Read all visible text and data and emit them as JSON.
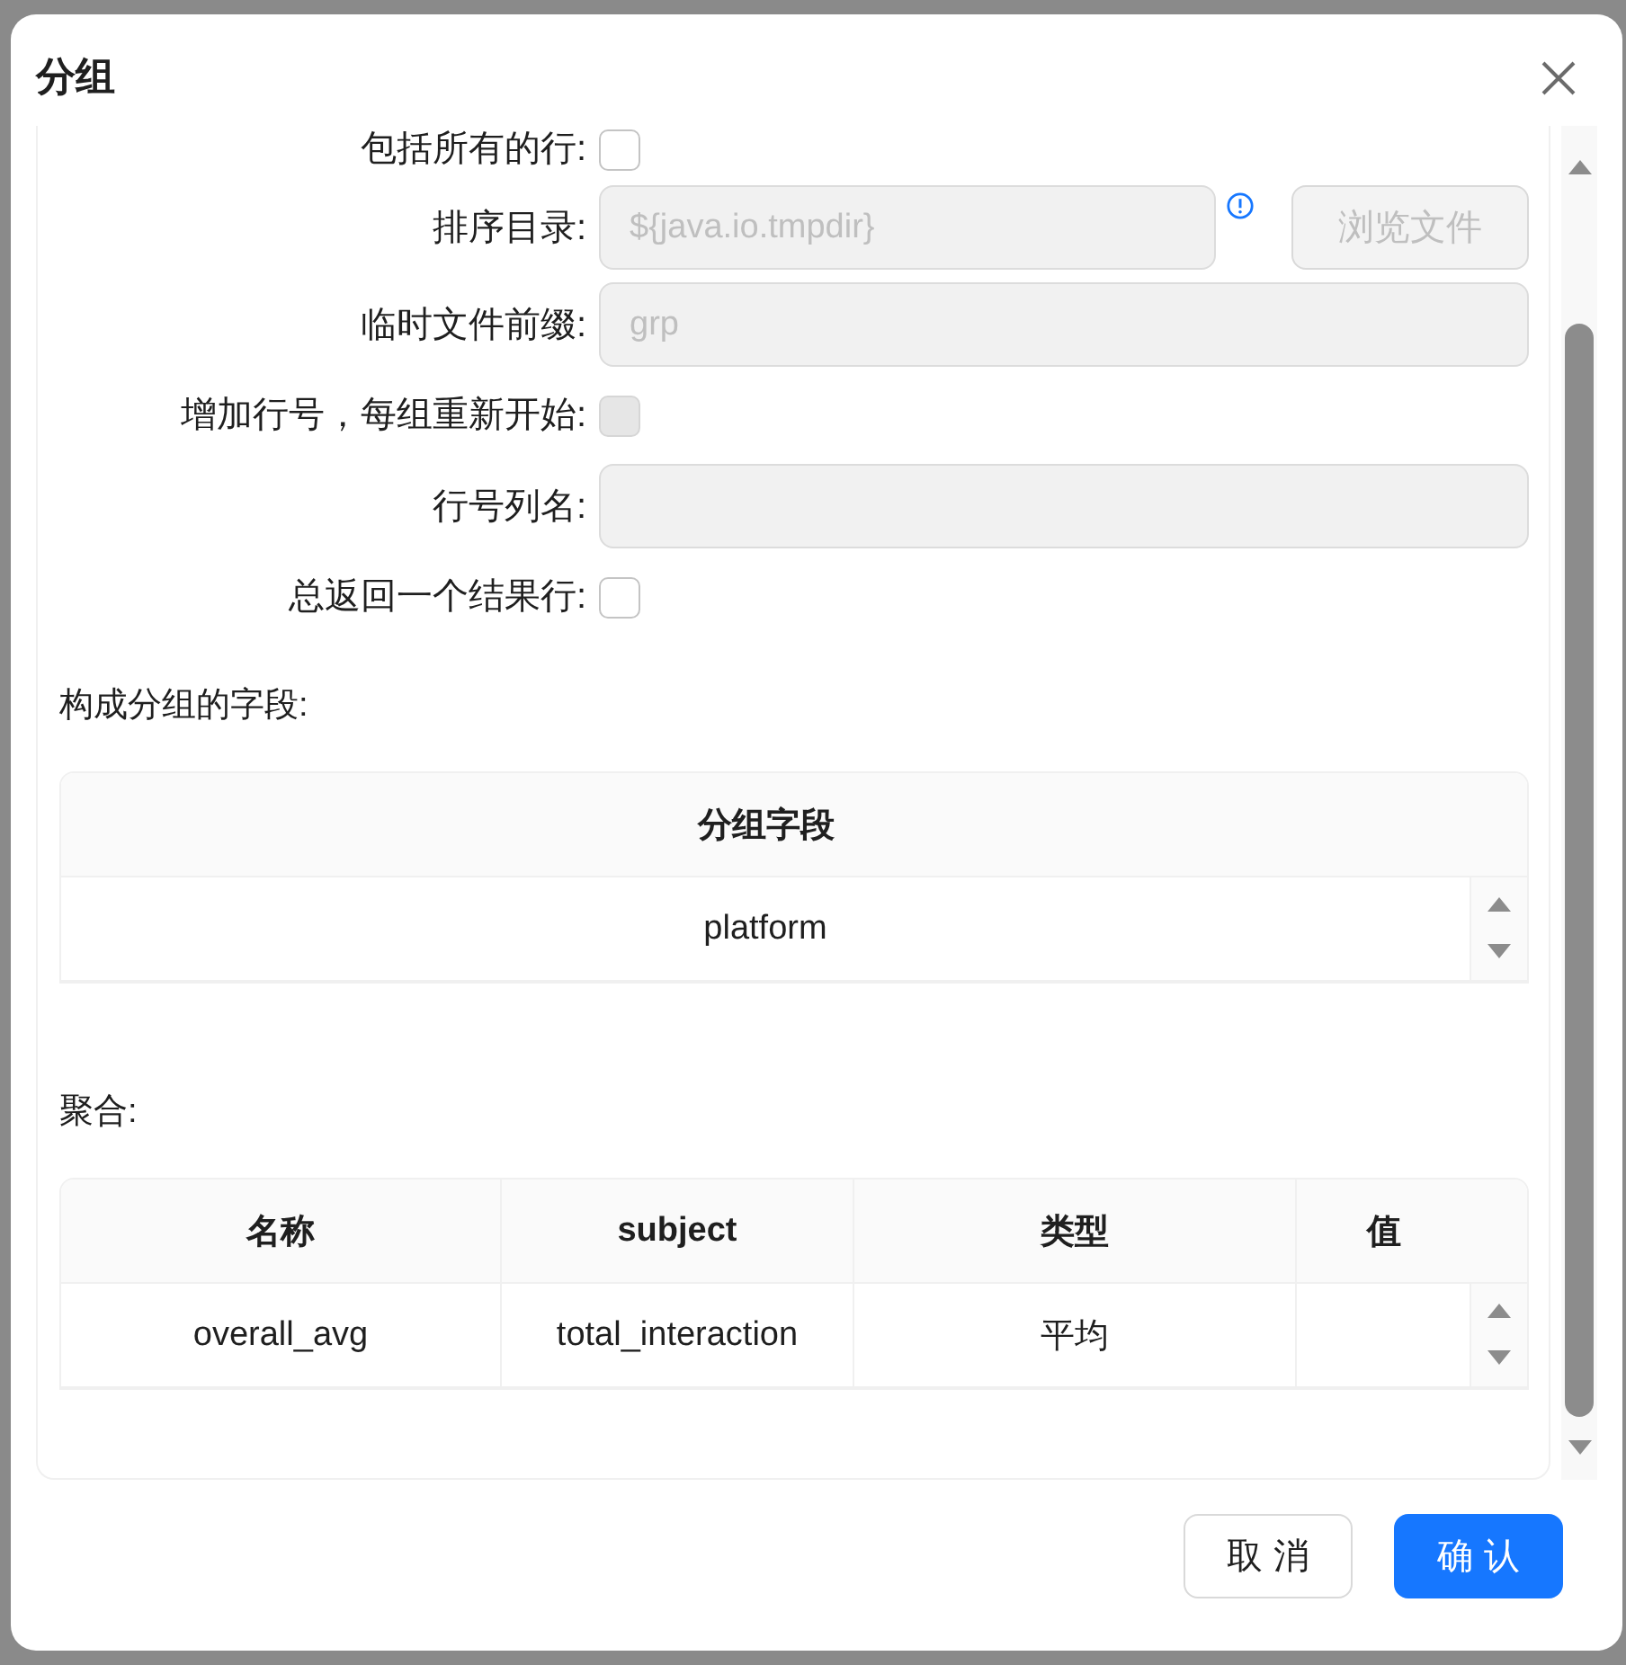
{
  "dialog": {
    "title": "分组"
  },
  "form_rows": [
    {
      "kind": "checkbox",
      "label": "包括所有的行:",
      "checked": false,
      "disabled": false
    },
    {
      "kind": "directory",
      "label": "排序目录:",
      "value": "${java.io.tmpdir}",
      "disabled": true,
      "button": {
        "label": "浏览文件",
        "disabled": true
      }
    },
    {
      "kind": "input",
      "label": "临时文件前缀:",
      "value": "grp",
      "disabled": true
    },
    {
      "kind": "checkbox",
      "label": "增加行号，每组重新开始:",
      "checked": false,
      "disabled": true
    },
    {
      "kind": "input",
      "label": "行号列名:",
      "disabled": true
    },
    {
      "kind": "checkbox",
      "label": "总返回一个结果行:",
      "checked": false,
      "disabled": false
    }
  ],
  "group_fields": {
    "heading": "构成分组的字段:",
    "columns": [
      "分组字段"
    ],
    "rows": [
      {
        "cells": [
          "platform"
        ]
      }
    ]
  },
  "aggregates": {
    "heading": "聚合:",
    "columns": [
      "名称",
      "subject",
      "类型",
      "值"
    ],
    "rows": [
      {
        "cells": [
          "overall_avg",
          "total_interaction",
          "平均"
        ]
      }
    ]
  },
  "buttons": [
    {
      "kind": "default",
      "label": "取 消"
    },
    {
      "kind": "primary",
      "label": "确 认"
    }
  ]
}
